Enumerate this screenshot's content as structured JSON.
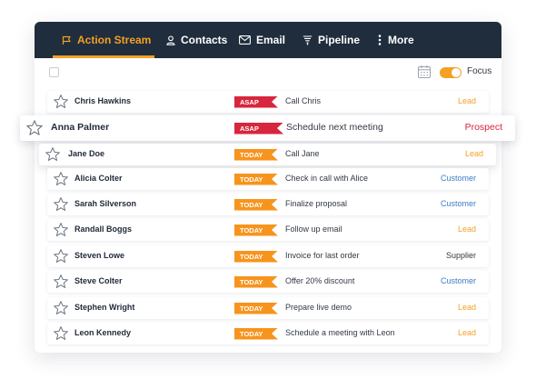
{
  "nav": {
    "items": [
      {
        "label": "Action Stream",
        "active": true,
        "icon": "flag-icon"
      },
      {
        "label": "Contacts",
        "icon": "user-icon"
      },
      {
        "label": "Email",
        "icon": "envelope-icon"
      },
      {
        "label": "Pipeline",
        "icon": "funnel-icon"
      },
      {
        "label": "More",
        "icon": "vertical-dots-icon"
      }
    ]
  },
  "toolbar": {
    "focus_label": "Focus",
    "focus_on": true
  },
  "colors": {
    "navbar": "#1f2d3d",
    "accent": "#f4a024",
    "asap": "#d7263d",
    "today": "#f7941d",
    "lead": "#f4a024",
    "prospect": "#d7263d",
    "customer": "#3a7ec8",
    "supplier": "#333a44"
  },
  "rows": [
    {
      "name": "Chris Hawkins",
      "badge": "ASAP",
      "task": "Call Chris",
      "status": "Lead"
    },
    {
      "name": "Anna Palmer",
      "badge": "ASAP",
      "task": "Schedule next meeting",
      "status": "Prospect"
    },
    {
      "name": "Jane Doe",
      "badge": "TODAY",
      "task": "Call Jane",
      "status": "Lead"
    },
    {
      "name": "Alicia Colter",
      "badge": "TODAY",
      "task": "Check in call with Alice",
      "status": "Customer"
    },
    {
      "name": "Sarah Silverson",
      "badge": "TODAY",
      "task": "Finalize proposal",
      "status": "Customer"
    },
    {
      "name": "Randall Boggs",
      "badge": "TODAY",
      "task": "Follow up email",
      "status": "Lead"
    },
    {
      "name": "Steven Lowe",
      "badge": "TODAY",
      "task": "Invoice for last order",
      "status": "Supplier"
    },
    {
      "name": "Steve Colter",
      "badge": "TODAY",
      "task": "Offer 20% discount",
      "status": "Customer"
    },
    {
      "name": "Stephen Wright",
      "badge": "TODAY",
      "task": "Prepare live demo",
      "status": "Lead"
    },
    {
      "name": "Leon Kennedy",
      "badge": "TODAY",
      "task": "Schedule a meeting with Leon",
      "status": "Lead"
    }
  ]
}
